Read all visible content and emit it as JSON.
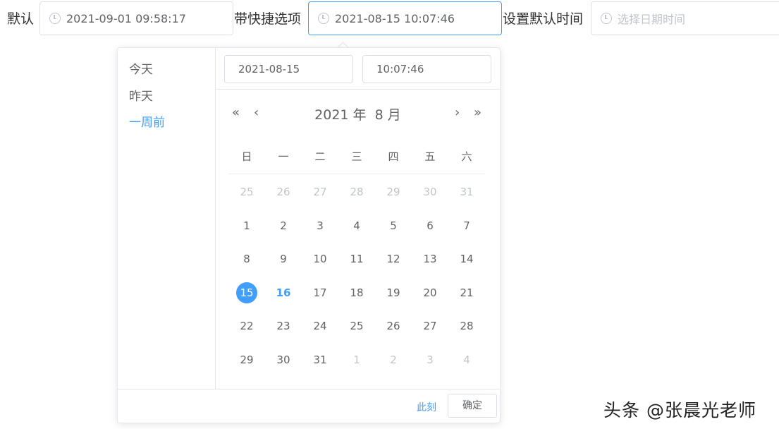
{
  "fields": [
    {
      "label": "默认",
      "value": "2021-09-01 09:58:17",
      "placeholder": ""
    },
    {
      "label": "带快捷选项",
      "value": "2021-08-15 10:07:46",
      "placeholder": ""
    },
    {
      "label": "设置默认时间",
      "value": "",
      "placeholder": "选择日期时间"
    }
  ],
  "picker": {
    "shortcuts": [
      "今天",
      "昨天",
      "一周前"
    ],
    "active_shortcut": "一周前",
    "date_input": "2021-08-15",
    "time_input": "10:07:46",
    "nav": {
      "prev_year": "«",
      "prev_month": "‹",
      "next_month": "›",
      "next_year": "»"
    },
    "year_label": "2021 年",
    "month_label": "8 月",
    "weekdays": [
      "日",
      "一",
      "二",
      "三",
      "四",
      "五",
      "六"
    ],
    "weeks": [
      [
        "25",
        "26",
        "27",
        "28",
        "29",
        "30",
        "31"
      ],
      [
        "1",
        "2",
        "3",
        "4",
        "5",
        "6",
        "7"
      ],
      [
        "8",
        "9",
        "10",
        "11",
        "12",
        "13",
        "14"
      ],
      [
        "15",
        "16",
        "17",
        "18",
        "19",
        "20",
        "21"
      ],
      [
        "22",
        "23",
        "24",
        "25",
        "26",
        "27",
        "28"
      ],
      [
        "29",
        "30",
        "31",
        "1",
        "2",
        "3",
        "4"
      ]
    ],
    "selected_day": "15",
    "today_day": "16",
    "now_label": "此刻",
    "confirm_label": "确定"
  },
  "colors": {
    "accent": "#409eff",
    "muted": "#c0c4cc",
    "text": "#606266"
  },
  "watermark": "头条 @张晨光老师"
}
